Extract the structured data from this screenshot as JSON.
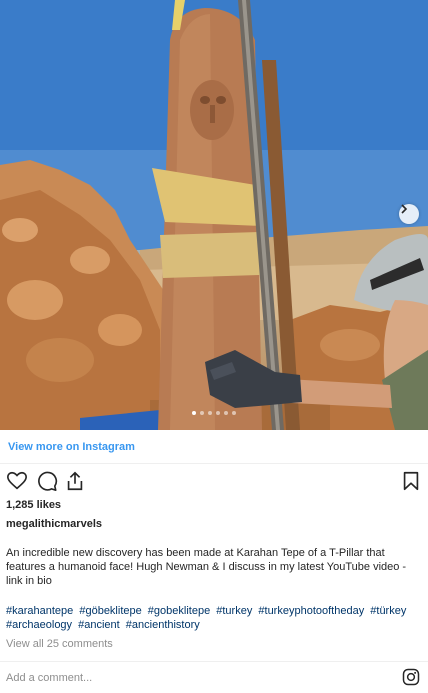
{
  "post": {
    "photo": {
      "carousel_dots": 6,
      "active_dot": 0,
      "next_icon": "chevron-right-icon"
    },
    "view_more": "View more on Instagram",
    "actions": {
      "like_icon": "heart-icon",
      "comment_icon": "comment-icon",
      "share_icon": "share-icon",
      "save_icon": "bookmark-icon"
    },
    "likes": "1,285 likes",
    "username": "megalithicmarvels",
    "caption": "An incredible new discovery has been made at Karahan Tepe of a T-Pillar that features a humanoid face! Hugh Newman & I discuss in my latest YouTube video - link in bio",
    "hashtags": [
      "#karahantepe",
      "#göbeklitepe",
      "#gobeklitepe",
      "#turkey",
      "#turkeyphotooftheday",
      "#türkey",
      "#archaeology",
      "#ancient",
      "#ancienthistory"
    ],
    "view_comments": "View all 25 comments",
    "add_comment_placeholder": "Add a comment...",
    "colors": {
      "link": "#3897f0",
      "hashtag": "#003569",
      "muted": "#8e8e8e"
    }
  }
}
